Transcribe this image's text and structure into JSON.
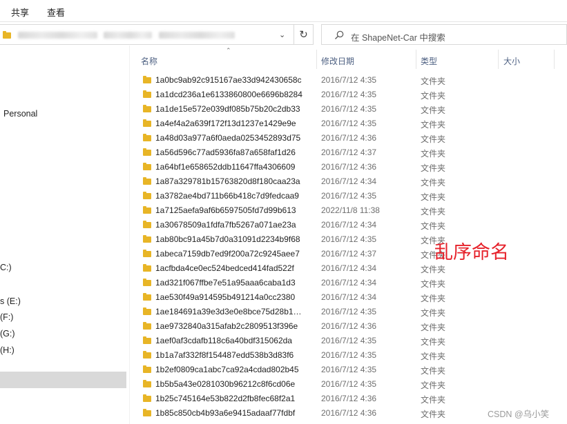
{
  "ribbon": {
    "tabs": [
      "共享",
      "查看"
    ]
  },
  "search": {
    "placeholder": "在 ShapeNet-Car 中搜索"
  },
  "nav": {
    "items": [
      {
        "label": "Personal"
      },
      {
        "label": "C:)"
      },
      {
        "label": "s (E:)"
      },
      {
        "label": "(F:)"
      },
      {
        "label": "(G:)",
        "selected": true
      },
      {
        "label": "(H:)"
      }
    ]
  },
  "columns": {
    "name": "名称",
    "date": "修改日期",
    "type": "类型",
    "size": "大小"
  },
  "files": [
    {
      "name": "1a0bc9ab92c915167ae33d942430658c",
      "date": "2016/7/12 4:35",
      "type": "文件夹"
    },
    {
      "name": "1a1dcd236a1e6133860800e6696b8284",
      "date": "2016/7/12 4:35",
      "type": "文件夹"
    },
    {
      "name": "1a1de15e572e039df085b75b20c2db33",
      "date": "2016/7/12 4:35",
      "type": "文件夹"
    },
    {
      "name": "1a4ef4a2a639f172f13d1237e1429e9e",
      "date": "2016/7/12 4:35",
      "type": "文件夹"
    },
    {
      "name": "1a48d03a977a6f0aeda0253452893d75",
      "date": "2016/7/12 4:36",
      "type": "文件夹"
    },
    {
      "name": "1a56d596c77ad5936fa87a658faf1d26",
      "date": "2016/7/12 4:37",
      "type": "文件夹"
    },
    {
      "name": "1a64bf1e658652ddb11647ffa4306609",
      "date": "2016/7/12 4:36",
      "type": "文件夹"
    },
    {
      "name": "1a87a329781b15763820d8f180caa23a",
      "date": "2016/7/12 4:34",
      "type": "文件夹"
    },
    {
      "name": "1a3782ae4bd711b66b418c7d9fedcaa9",
      "date": "2016/7/12 4:35",
      "type": "文件夹"
    },
    {
      "name": "1a7125aefa9af6b6597505fd7d99b613",
      "date": "2022/11/8 11:38",
      "type": "文件夹"
    },
    {
      "name": "1a30678509a1fdfa7fb5267a071ae23a",
      "date": "2016/7/12 4:34",
      "type": "文件夹"
    },
    {
      "name": "1ab80bc91a45b7d0a31091d2234b9f68",
      "date": "2016/7/12 4:35",
      "type": "文件夹"
    },
    {
      "name": "1abeca7159db7ed9f200a72c9245aee7",
      "date": "2016/7/12 4:37",
      "type": "文件夹"
    },
    {
      "name": "1acfbda4ce0ec524bedced414fad522f",
      "date": "2016/7/12 4:34",
      "type": "文件夹"
    },
    {
      "name": "1ad321f067ffbe7e51a95aaa6caba1d3",
      "date": "2016/7/12 4:34",
      "type": "文件夹"
    },
    {
      "name": "1ae530f49a914595b491214a0cc2380",
      "date": "2016/7/12 4:34",
      "type": "文件夹"
    },
    {
      "name": "1ae184691a39e3d3e0e8bce75d28b1…",
      "date": "2016/7/12 4:35",
      "type": "文件夹"
    },
    {
      "name": "1ae9732840a315afab2c2809513f396e",
      "date": "2016/7/12 4:36",
      "type": "文件夹"
    },
    {
      "name": "1aef0af3cdafb118c6a40bdf315062da",
      "date": "2016/7/12 4:35",
      "type": "文件夹"
    },
    {
      "name": "1b1a7af332f8f154487edd538b3d83f6",
      "date": "2016/7/12 4:35",
      "type": "文件夹"
    },
    {
      "name": "1b2ef0809ca1abc7ca92a4cdad802b45",
      "date": "2016/7/12 4:35",
      "type": "文件夹"
    },
    {
      "name": "1b5b5a43e0281030b96212c8f6cd06e",
      "date": "2016/7/12 4:35",
      "type": "文件夹"
    },
    {
      "name": "1b25c745164e53b822d2fb8fec68f2a1",
      "date": "2016/7/12 4:36",
      "type": "文件夹"
    },
    {
      "name": "1b85c850cb4b93a6e9415adaaf77fdbf",
      "date": "2016/7/12 4:36",
      "type": "文件夹"
    }
  ],
  "annotation": "乱序命名",
  "watermark": "CSDN @乌小笑",
  "colors": {
    "annotation": "#e6212a",
    "folder": "#e8b526",
    "header_text": "#4d6082",
    "selection": "#d9d9d9"
  }
}
